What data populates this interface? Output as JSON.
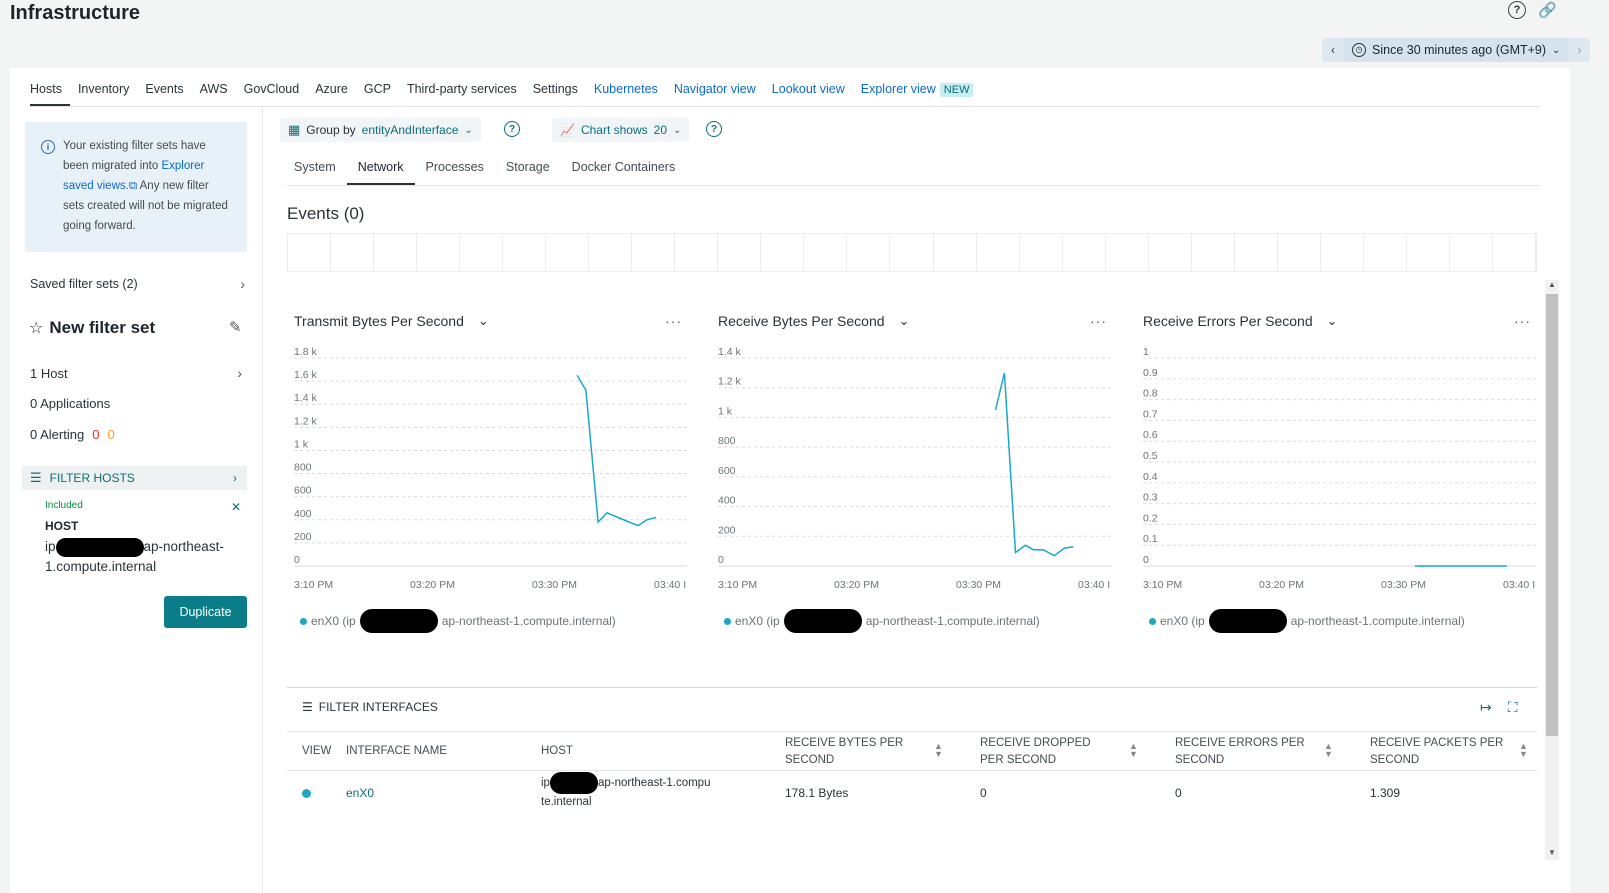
{
  "header": {
    "title": "Infrastructure"
  },
  "time_picker": {
    "label": "Since 30 minutes ago (GMT+9)"
  },
  "tabs": [
    {
      "label": "Hosts",
      "active": true,
      "link": false
    },
    {
      "label": "Inventory",
      "active": false,
      "link": false
    },
    {
      "label": "Events",
      "active": false,
      "link": false
    },
    {
      "label": "AWS",
      "active": false,
      "link": false
    },
    {
      "label": "GovCloud",
      "active": false,
      "link": false
    },
    {
      "label": "Azure",
      "active": false,
      "link": false
    },
    {
      "label": "GCP",
      "active": false,
      "link": false
    },
    {
      "label": "Third-party services",
      "active": false,
      "link": false
    },
    {
      "label": "Settings",
      "active": false,
      "link": false
    },
    {
      "label": "Kubernetes",
      "active": false,
      "link": true
    },
    {
      "label": "Navigator view",
      "active": false,
      "link": true
    },
    {
      "label": "Lookout view",
      "active": false,
      "link": true
    },
    {
      "label": "Explorer view",
      "active": false,
      "link": true
    }
  ],
  "new_badge": "NEW",
  "sidebar": {
    "info_text_1": "Your existing filter sets have been migrated into",
    "info_link": "Explorer saved views.",
    "info_text_2": "Any new filter sets created will not be migrated going forward.",
    "saved_filter_sets": "Saved filter sets (2)",
    "new_filter_set": "New filter set",
    "hosts": "1 Host",
    "applications": "0 Applications",
    "alerting": "0 Alerting",
    "alert_red": "0",
    "alert_orange": "0",
    "filter_hosts": "FILTER HOSTS",
    "included": "Included",
    "host_label": "HOST",
    "host_prefix": "ip",
    "host_suffix": "ap-northeast-1.compute.internal",
    "duplicate": "Duplicate"
  },
  "toolbar": {
    "group_by_label": "Group by",
    "group_by_value": "entityAndInterface",
    "chart_shows_label": "Chart shows",
    "chart_shows_value": "20"
  },
  "subtabs": [
    {
      "label": "System",
      "active": false
    },
    {
      "label": "Network",
      "active": true
    },
    {
      "label": "Processes",
      "active": false
    },
    {
      "label": "Storage",
      "active": false
    },
    {
      "label": "Docker Containers",
      "active": false
    }
  ],
  "events_title": "Events (0)",
  "legend": {
    "prefix": "enX0 (ip",
    "suffix": "ap-northeast-1.compute.internal)"
  },
  "colors": {
    "series": "#1aa9c4",
    "accent": "#0b7d88",
    "link": "#0b6acb"
  },
  "chart_data": [
    {
      "type": "line",
      "title": "Transmit Bytes Per Second",
      "x_ticks": [
        "3:10 PM",
        "03:20 PM",
        "03:30 PM",
        "03:40 I"
      ],
      "y_ticks": [
        "1.8 k",
        "1.6 k",
        "1.4 k",
        "1.2 k",
        "1 k",
        "800",
        "600",
        "400",
        "200",
        "0"
      ],
      "ylim": [
        0,
        1800
      ],
      "x_range": [
        0,
        30
      ],
      "series": [
        {
          "values": [
            [
              25.5,
              1650
            ],
            [
              26.3,
              1520
            ],
            [
              27.4,
              380
            ],
            [
              28.2,
              460
            ],
            [
              29.2,
              420
            ],
            [
              30.2,
              380
            ],
            [
              31.0,
              350
            ],
            [
              31.8,
              400
            ],
            [
              32.6,
              420
            ]
          ]
        }
      ]
    },
    {
      "type": "line",
      "title": "Receive Bytes Per Second",
      "x_ticks": [
        "3:10 PM",
        "03:20 PM",
        "03:30 PM",
        "03:40 I"
      ],
      "y_ticks": [
        "1.4 k",
        "1.2 k",
        "1 k",
        "800",
        "600",
        "400",
        "200",
        "0"
      ],
      "ylim": [
        0,
        1400
      ],
      "x_range": [
        0,
        30
      ],
      "series": [
        {
          "values": [
            [
              25.0,
              1050
            ],
            [
              25.8,
              1300
            ],
            [
              26.8,
              90
            ],
            [
              27.7,
              140
            ],
            [
              28.4,
              110
            ],
            [
              29.3,
              110
            ],
            [
              30.3,
              70
            ],
            [
              31.2,
              120
            ],
            [
              32.0,
              130
            ]
          ]
        }
      ]
    },
    {
      "type": "line",
      "title": "Receive Errors Per Second",
      "x_ticks": [
        "3:10 PM",
        "03:20 PM",
        "03:30 PM",
        "03:40 I"
      ],
      "y_ticks": [
        "1",
        "0.9",
        "0.8",
        "0.7",
        "0.6",
        "0.5",
        "0.4",
        "0.3",
        "0.2",
        "0.1",
        "0"
      ],
      "ylim": [
        0,
        1
      ],
      "x_range": [
        0,
        30
      ],
      "series": [
        {
          "values": [
            [
              24.5,
              0
            ],
            [
              32.8,
              0
            ]
          ]
        }
      ]
    }
  ],
  "table": {
    "filter_label": "FILTER INTERFACES",
    "headers": {
      "view": "VIEW",
      "interface": "INTERFACE NAME",
      "host": "HOST",
      "rx_bytes": "RECEIVE BYTES PER SECOND",
      "rx_dropped": "RECEIVE DROPPED PER SECOND",
      "rx_errors": "RECEIVE ERRORS PER SECOND",
      "rx_packets": "RECEIVE PACKETS PER SECOND"
    },
    "rows": [
      {
        "interface": "enX0",
        "host_prefix": "ip",
        "host_suffix_1": "ap-northeast-1.compu",
        "host_suffix_2": "te.internal",
        "rx_bytes": "178.1 Bytes",
        "rx_dropped": "0",
        "rx_errors": "0",
        "rx_packets": "1.309"
      }
    ]
  }
}
